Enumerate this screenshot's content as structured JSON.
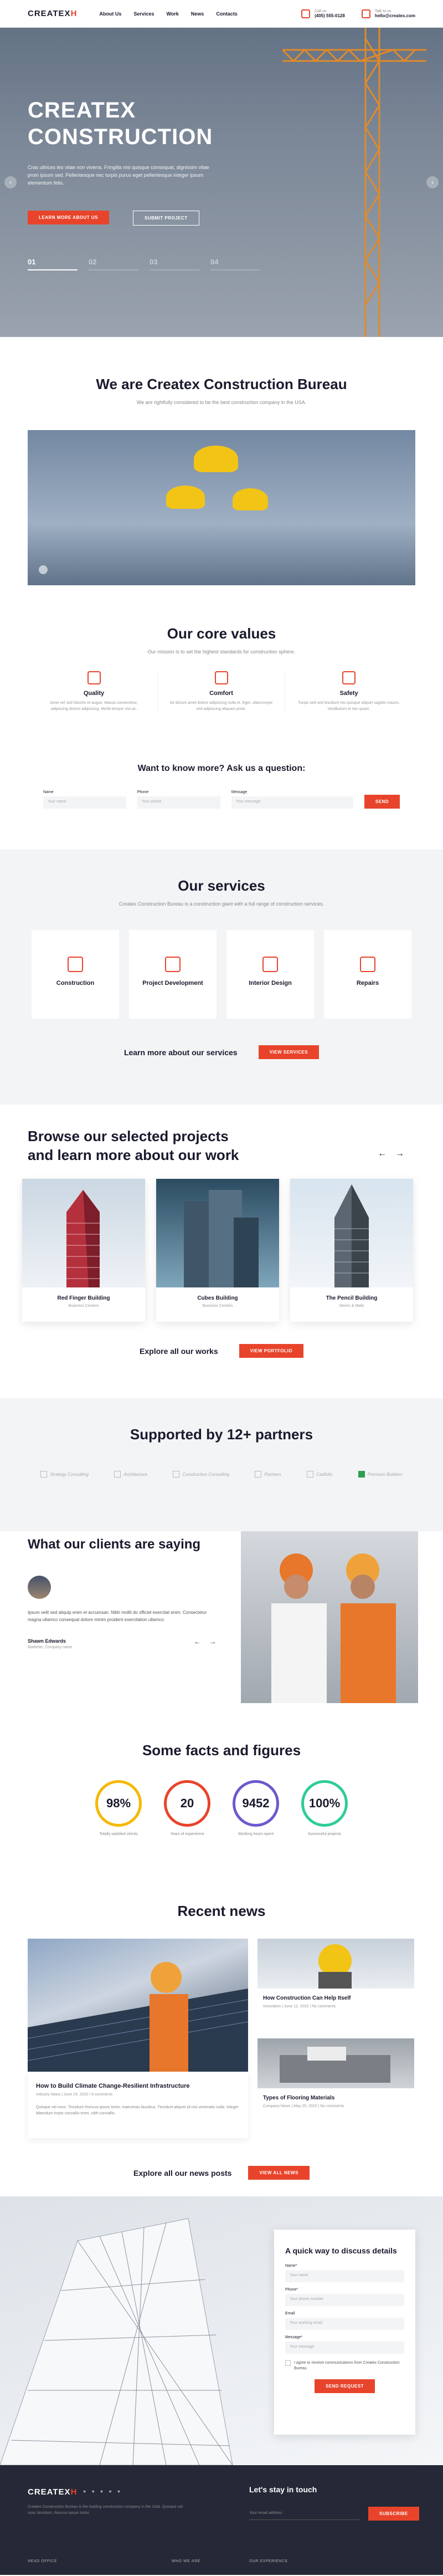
{
  "header": {
    "logo": "CREATEX",
    "logo_mark": "H",
    "nav": [
      "About Us",
      "Services",
      "Work",
      "News",
      "Contacts"
    ],
    "call_label": "Call us",
    "call_value": "(405) 555-0128",
    "talk_label": "Talk to us",
    "talk_value": "hello@createx.com"
  },
  "hero": {
    "title_line1": "CREATEX",
    "title_line2": "CONSTRUCTION",
    "text": "Cras ultrices leo vitae non viverra. Fringilla nisi quisque consequat, dignissim vitae proin ipsum sed. Pellentesque nec turpis purus eget pellentesque integer ipsum elementum felis.",
    "btn_learn": "Learn more about us",
    "btn_submit": "Submit project",
    "slides": [
      "01",
      "02",
      "03",
      "04"
    ]
  },
  "about": {
    "title": "We are Createx Construction Bureau",
    "subtitle": "We are rightfully considered to be the best construction company in the USA."
  },
  "core": {
    "title": "Our core values",
    "subtitle": "Our mission is to set the highest standards for construction sphere.",
    "values": [
      {
        "title": "Quality",
        "text": "Amet vel sed lobortis et augue. Massa consectetur, adipiscing dictum adipiscing. Morbi tempor nisi ac."
      },
      {
        "title": "Comfort",
        "text": "Sit dictum amet dolore adipiscing nulla et. Eget, ullamcorper sed adipiscing aliquam proin."
      },
      {
        "title": "Safety",
        "text": "Turpis sed sed tincidunt nisi quisque aliquet sagittis mauris. Vestibulum et nec quam."
      }
    ]
  },
  "ask": {
    "title": "Want to know more? Ask us a question:",
    "name_label": "Name",
    "name_ph": "Your name",
    "phone_label": "Phone",
    "phone_ph": "Your phone",
    "msg_label": "Message",
    "msg_ph": "Your message",
    "send": "Send"
  },
  "services": {
    "title": "Our services",
    "subtitle": "Createx Construction Bureau is a construction giant with a full range of construction services.",
    "items": [
      "Construction",
      "Project Development",
      "Interior Design",
      "Repairs"
    ],
    "more_text": "Learn more about our services",
    "more_btn": "View services"
  },
  "projects": {
    "title_line1": "Browse our selected projects",
    "title_line2": "and learn more about our work",
    "items": [
      {
        "name": "Red Finger Building",
        "type": "Business Centers"
      },
      {
        "name": "Cubes Building",
        "type": "Business Centers"
      },
      {
        "name": "The Pencil Building",
        "type": "Stores & Malls"
      }
    ],
    "more_text": "Explore all our works",
    "more_btn": "View portfolio"
  },
  "partners": {
    "title": "Supported by 12+ partners",
    "logos": [
      "Strategy Consulting",
      "Architecture",
      "Construction Consulting",
      "Partners",
      "Cadfolio",
      "Premium Builders"
    ]
  },
  "testimonial": {
    "title": "What our clients are saying",
    "text": "Ipsum velit sed aliquip enim et accumsan. Nibh mollit do officiel exercitat enim. Consectetur magna ullamco consequat dolore minim proident exercitation ullamco.",
    "name": "Shawn Edwards",
    "role": "Marketer, Company name"
  },
  "facts": {
    "title": "Some facts and figures",
    "items": [
      {
        "value": "98%",
        "label": "Totally satisfied clients",
        "color": "#f5b800"
      },
      {
        "value": "20",
        "label": "Years of experience",
        "color": "#e8442b"
      },
      {
        "value": "9452",
        "label": "Working hours spent",
        "color": "#6a5acd"
      },
      {
        "value": "100%",
        "label": "Successful projects",
        "color": "#2ecc9a"
      }
    ]
  },
  "news": {
    "title": "Recent news",
    "big": {
      "title": "How to Build Climate Change-Resilient Infrastructure",
      "meta": "Industry News  |  June 24, 2020  |  4 comments",
      "text": "Quisque vel nunc. Tincidunt rhoncus ipsum tortor, maecenas faucibus. Tincidunt aliquet sit nisi venenatis nulla. Integer bibendum turpis convallis enim, nibh convallis."
    },
    "items": [
      {
        "title": "How Construction Can Help Itself",
        "meta": "Innovation  |  June 12, 2020  |  No comments"
      },
      {
        "title": "Types of Flooring Materials",
        "meta": "Company News  |  May 29, 2020  |  No comments"
      }
    ],
    "more_text": "Explore all our news posts",
    "more_btn": "View all news"
  },
  "contact": {
    "title": "A quick way to discuss details",
    "name_label": "Name*",
    "name_ph": "Your name",
    "phone_label": "Phone*",
    "phone_ph": "Your phone number",
    "email_label": "Email",
    "email_ph": "Your working email",
    "msg_label": "Message*",
    "msg_ph": "Your message",
    "consent": "I agree to receive communications from Createx Construction Bureau.",
    "send": "Send request"
  },
  "footer": {
    "logo": "CREATEX",
    "logo_mark": "H",
    "desc": "Createx Construction Bureau is the leading construction company in the USA. Quisque vel nunc tincidunt, rhoncus ipsum tortor.",
    "stay": "Let's stay in touch",
    "email_ph": "Your email address",
    "subscribe": "Subscribe",
    "cols": [
      "HEAD OFFICE",
      "WHO WE ARE",
      "OUR EXPERIENCE"
    ]
  }
}
